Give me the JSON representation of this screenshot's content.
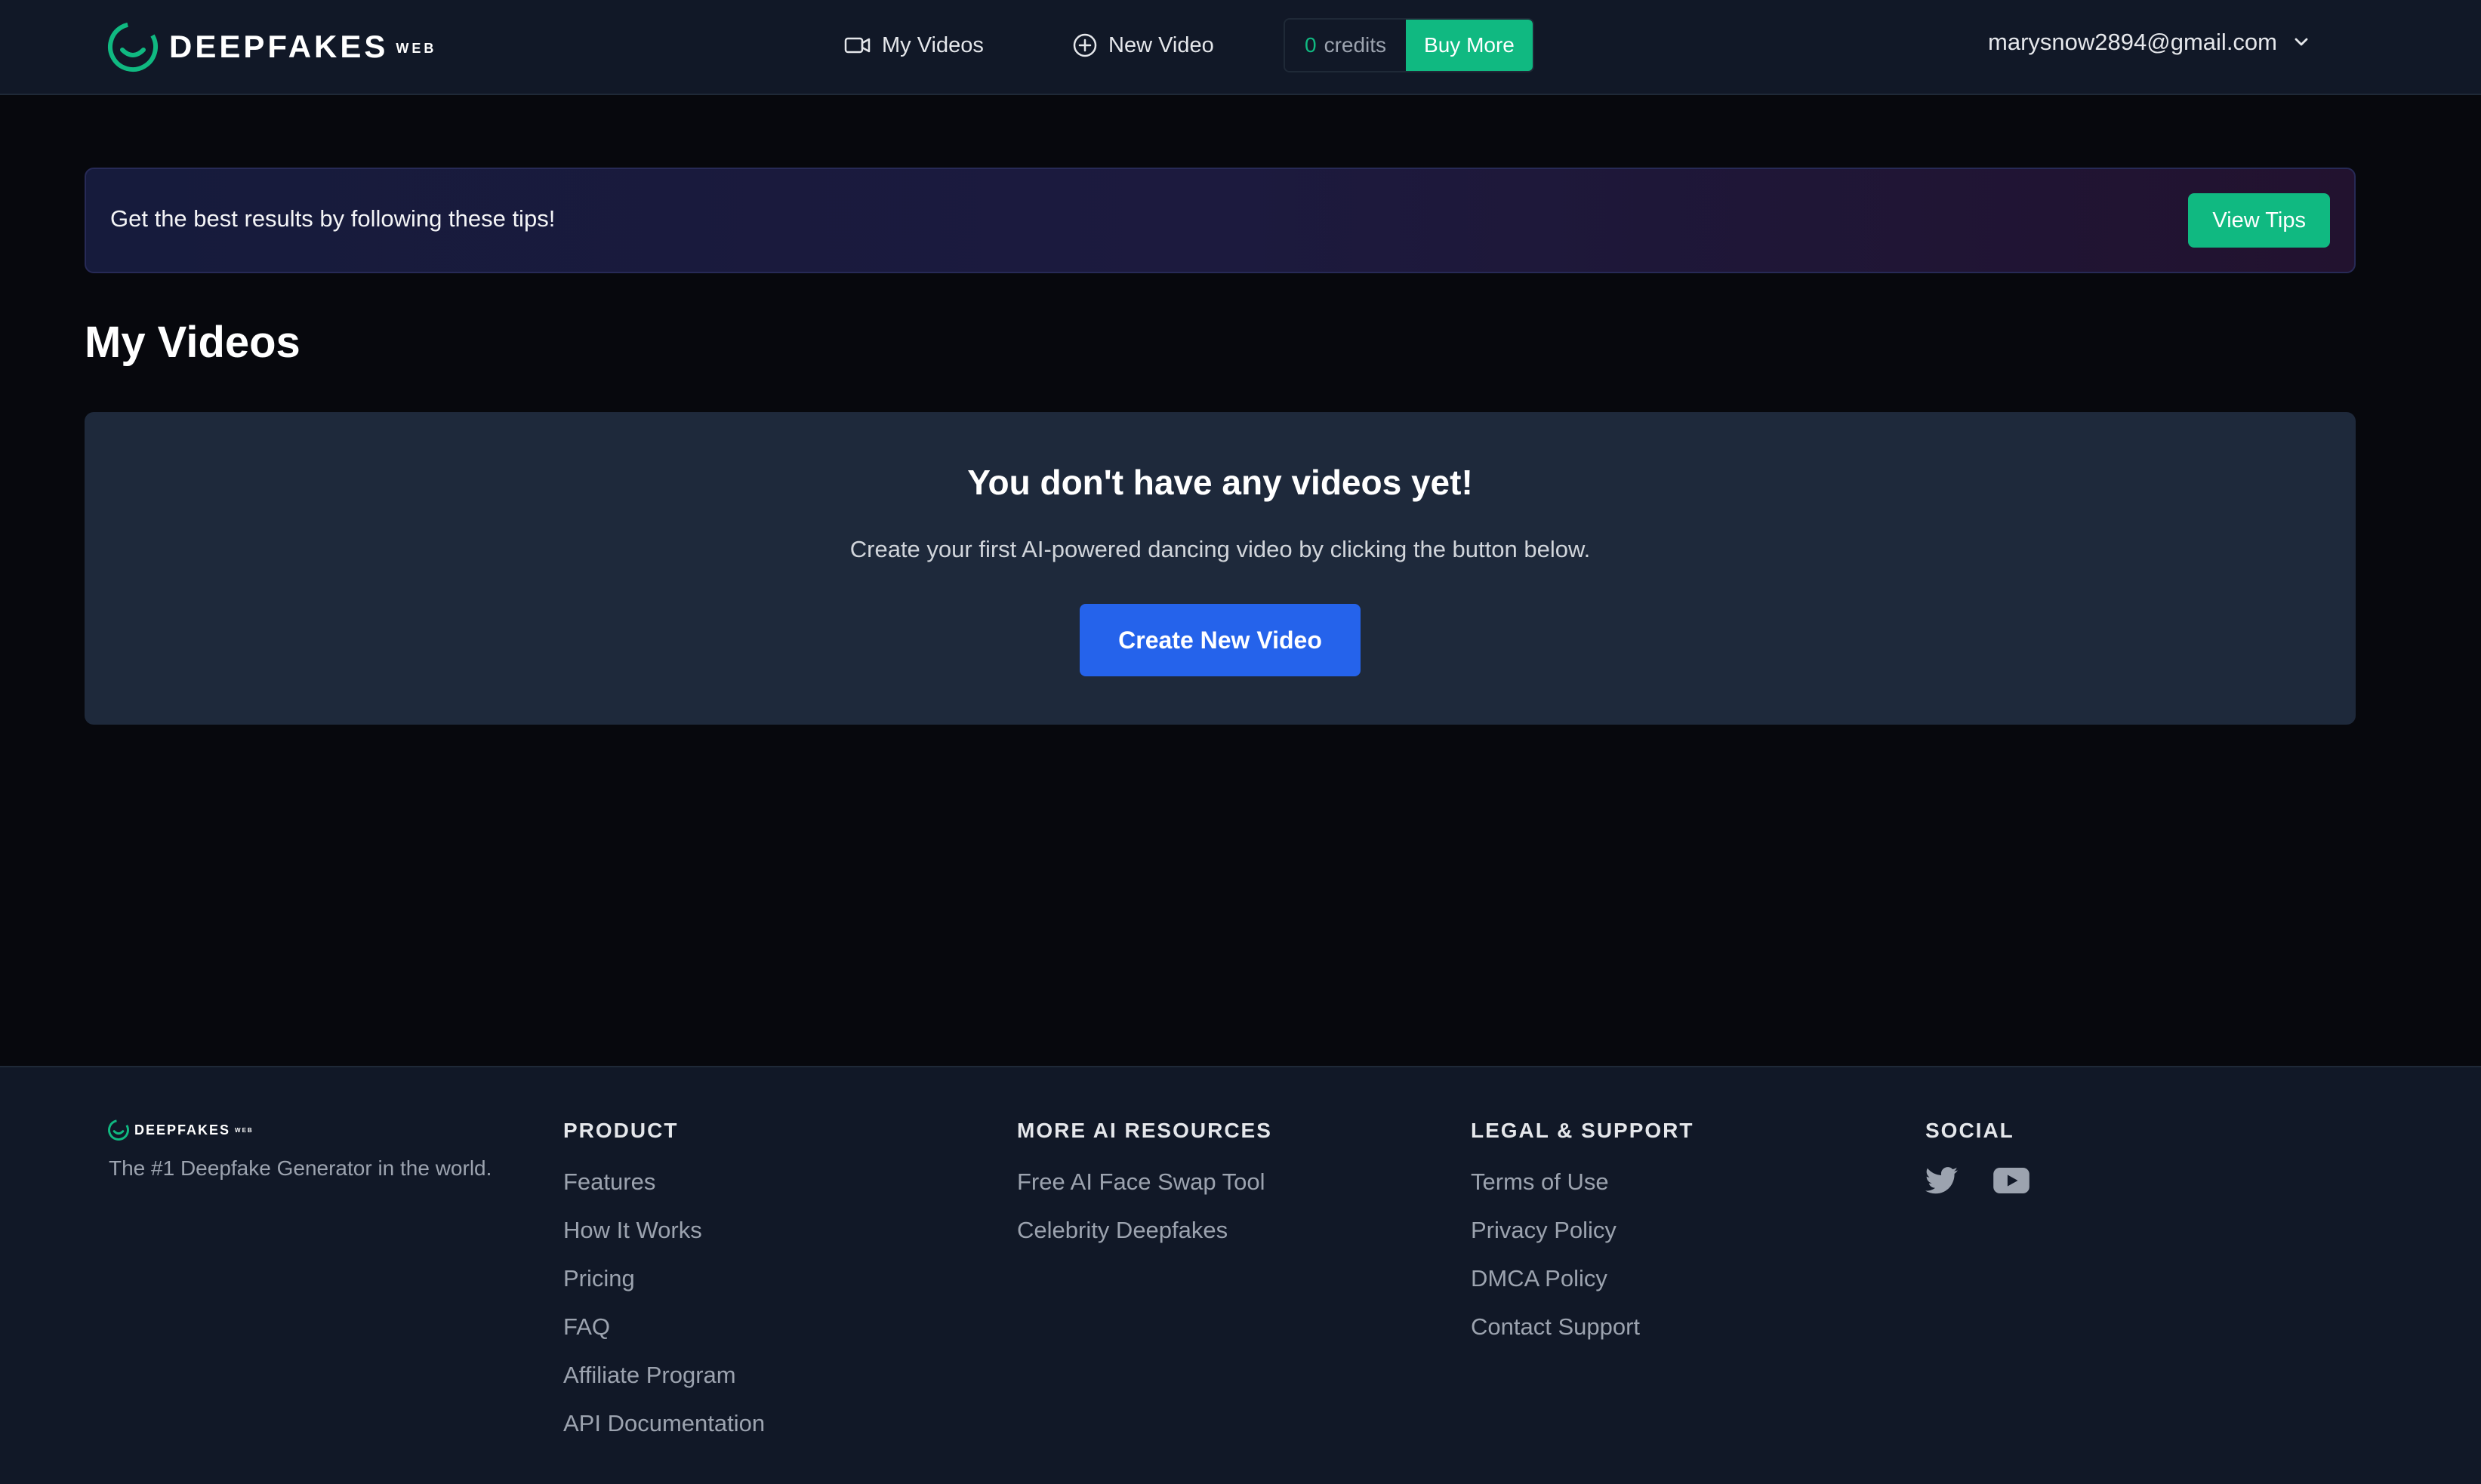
{
  "header": {
    "logo_text": "DEEPFAKES",
    "logo_sub": "WEB",
    "nav": {
      "my_videos": "My Videos",
      "new_video": "New Video"
    },
    "credits": {
      "count": "0",
      "label": "credits",
      "buy_more": "Buy More"
    },
    "user_email": "marysnow2894@gmail.com"
  },
  "tips_banner": {
    "text": "Get the best results by following these tips!",
    "button": "View Tips"
  },
  "main": {
    "title": "My Videos",
    "empty_state": {
      "title": "You don't have any videos yet!",
      "description": "Create your first AI-powered dancing video by clicking the button below.",
      "button": "Create New Video"
    }
  },
  "footer": {
    "logo_text": "DEEPFAKES",
    "logo_sub": "WEB",
    "tagline": "The #1 Deepfake Generator in the world.",
    "product": {
      "heading": "PRODUCT",
      "links": [
        "Features",
        "How It Works",
        "Pricing",
        "FAQ",
        "Affiliate Program",
        "API Documentation"
      ]
    },
    "resources": {
      "heading": "MORE AI RESOURCES",
      "links": [
        "Free AI Face Swap Tool",
        "Celebrity Deepfakes"
      ]
    },
    "legal": {
      "heading": "LEGAL & SUPPORT",
      "links": [
        "Terms of Use",
        "Privacy Policy",
        "DMCA Policy",
        "Contact Support"
      ]
    },
    "social": {
      "heading": "SOCIAL",
      "icons": [
        "twitter-icon",
        "youtube-icon"
      ]
    }
  },
  "colors": {
    "accent_green": "#10b981",
    "primary_blue": "#2563eb",
    "page_bg": "#07080d",
    "header_bg": "#111827",
    "card_bg": "#1e293b"
  }
}
